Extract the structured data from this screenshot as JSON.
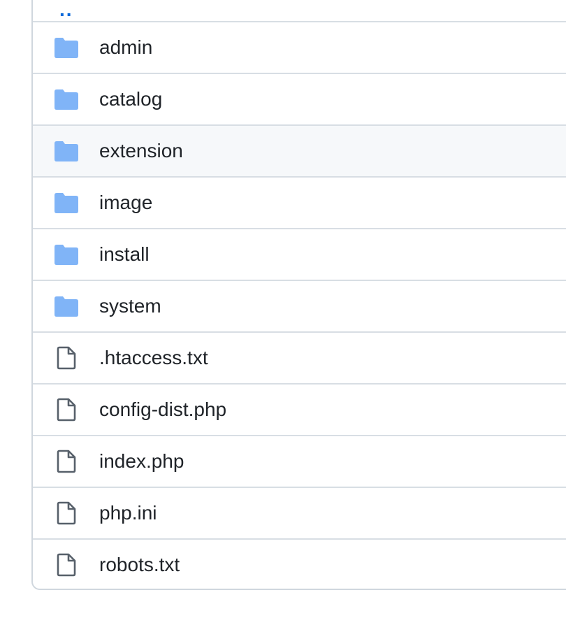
{
  "colors": {
    "folder": "#80b4f7",
    "file": "#57606a",
    "link": "#0969da",
    "border": "#d0d7de",
    "hover_bg": "#f6f8fa"
  },
  "parent_link": {
    "label": "..",
    "icon": "parent-dir"
  },
  "entries": [
    {
      "name": "admin",
      "type": "folder",
      "icon": "folder-icon"
    },
    {
      "name": "catalog",
      "type": "folder",
      "icon": "folder-icon"
    },
    {
      "name": "extension",
      "type": "folder",
      "icon": "folder-icon",
      "hovered": true
    },
    {
      "name": "image",
      "type": "folder",
      "icon": "folder-icon"
    },
    {
      "name": "install",
      "type": "folder",
      "icon": "folder-icon"
    },
    {
      "name": "system",
      "type": "folder",
      "icon": "folder-icon"
    },
    {
      "name": ".htaccess.txt",
      "type": "file",
      "icon": "file-icon"
    },
    {
      "name": "config-dist.php",
      "type": "file",
      "icon": "file-icon"
    },
    {
      "name": "index.php",
      "type": "file",
      "icon": "file-icon"
    },
    {
      "name": "php.ini",
      "type": "file",
      "icon": "file-icon"
    },
    {
      "name": "robots.txt",
      "type": "file",
      "icon": "file-icon"
    }
  ]
}
